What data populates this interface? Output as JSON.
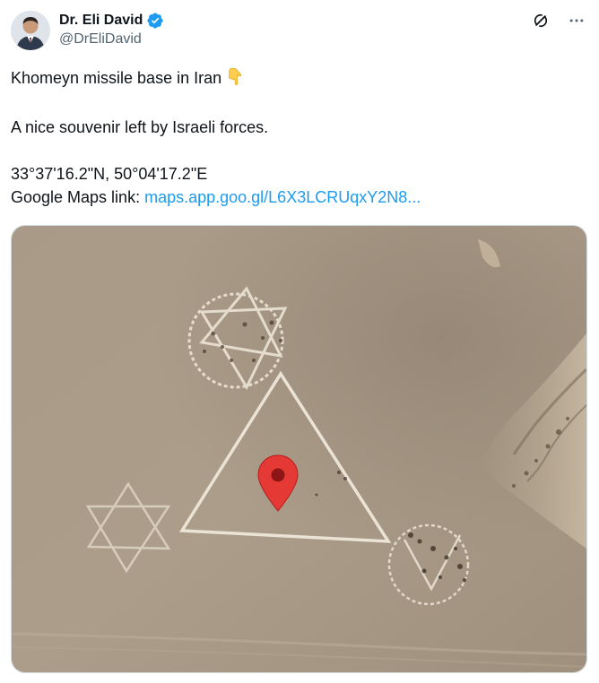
{
  "author": {
    "display_name": "Dr. Eli David",
    "handle": "@DrEliDavid",
    "verified": true
  },
  "actions": {
    "grok_icon": "grok-icon",
    "more_icon": "more-icon"
  },
  "tweet": {
    "line1": "Khomeyn missile base in Iran",
    "line1_emoji": "backhand-index-pointing-down",
    "line2": "A nice souvenir left by Israeli forces.",
    "coordinates": "33°37'16.2\"N, 50°04'17.2\"E",
    "maps_label": "Google Maps link: ",
    "maps_link": "maps.app.goo.gl/L6X3LCRUqxY2N8..."
  },
  "media": {
    "description_icon": "map-pin-icon"
  },
  "colors": {
    "link": "#1d9bf0",
    "verified": "#1d9bf0",
    "pin": "#e53935",
    "ground": "#a89a88"
  }
}
